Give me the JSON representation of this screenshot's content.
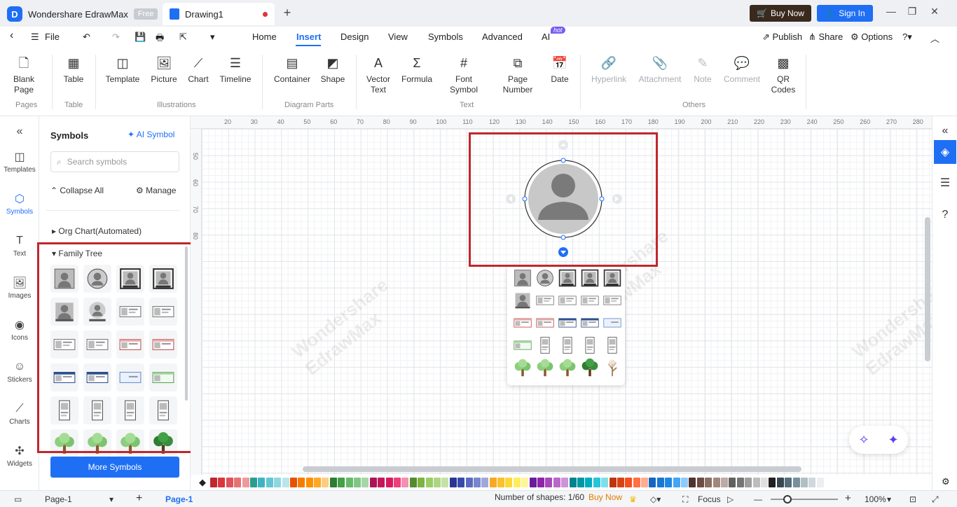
{
  "titlebar": {
    "app_name": "Wondershare EdrawMax",
    "free_badge": "Free",
    "doc_tab": "Drawing1",
    "buy_now": "Buy Now",
    "sign_in": "Sign In"
  },
  "menu": {
    "file": "File",
    "tabs": [
      "Home",
      "Insert",
      "Design",
      "View",
      "Symbols",
      "Advanced",
      "AI"
    ],
    "active_tab": "Insert",
    "hot_badge": "hot",
    "publish": "Publish",
    "share": "Share",
    "options": "Options"
  },
  "ribbon": {
    "buttons": [
      {
        "label": "Blank Page",
        "icon": "blank-page-icon"
      },
      {
        "label": "Table",
        "icon": "table-icon"
      },
      {
        "label": "Template",
        "icon": "template-icon"
      },
      {
        "label": "Picture",
        "icon": "picture-icon"
      },
      {
        "label": "Chart",
        "icon": "chart-icon"
      },
      {
        "label": "Timeline",
        "icon": "timeline-icon"
      },
      {
        "label": "Container",
        "icon": "container-icon"
      },
      {
        "label": "Shape",
        "icon": "shape-icon"
      },
      {
        "label": "Vector Text",
        "icon": "vector-text-icon"
      },
      {
        "label": "Formula",
        "icon": "formula-icon"
      },
      {
        "label": "Font Symbol",
        "icon": "font-symbol-icon"
      },
      {
        "label": "Page Number",
        "icon": "page-number-icon"
      },
      {
        "label": "Date",
        "icon": "date-icon"
      },
      {
        "label": "Hyperlink",
        "icon": "hyperlink-icon"
      },
      {
        "label": "Attachment",
        "icon": "attachment-icon"
      },
      {
        "label": "Note",
        "icon": "note-icon"
      },
      {
        "label": "Comment",
        "icon": "comment-icon"
      },
      {
        "label": "QR Codes",
        "icon": "qr-code-icon"
      }
    ],
    "groups": [
      "Pages",
      "Table",
      "Illustrations",
      "Diagram Parts",
      "Text",
      "Others"
    ]
  },
  "rail": {
    "items": [
      "Templates",
      "Symbols",
      "Text",
      "Images",
      "Icons",
      "Stickers",
      "Charts",
      "Widgets"
    ],
    "active": "Symbols"
  },
  "symbols_panel": {
    "title": "Symbols",
    "ai_symbol": "AI Symbol",
    "search_placeholder": "Search symbols",
    "collapse_all": "Collapse All",
    "manage": "Manage",
    "categories": [
      "Org Chart(Automated)",
      "Family Tree"
    ],
    "more_symbols": "More Symbols"
  },
  "ruler": {
    "top_ticks": [
      "20",
      "30",
      "40",
      "50",
      "60",
      "70",
      "80",
      "90",
      "100",
      "110",
      "120",
      "130",
      "140",
      "150",
      "160",
      "170",
      "180",
      "190",
      "200",
      "210",
      "220",
      "230",
      "240",
      "250",
      "260",
      "270",
      "280"
    ],
    "left_ticks": [
      "50",
      "60",
      "70",
      "80"
    ]
  },
  "watermark": {
    "line1": "Wondershare",
    "line2": "EdrawMax"
  },
  "status": {
    "page_select": "Page-1",
    "page_tab": "Page-1",
    "shapes_count": "Number of shapes: 1/60",
    "buy_now": "Buy Now",
    "focus": "Focus",
    "zoom": "100%"
  },
  "colors": {
    "accent": "#1f6ff5",
    "highlight_box": "#c0272d",
    "palette": [
      "#c0272d",
      "#d9363e",
      "#e0525a",
      "#e57373",
      "#ef9a9a",
      "#2a9d8f",
      "#3fb3c4",
      "#63c6d3",
      "#8fd6e0",
      "#b8e6ec",
      "#e65100",
      "#f57c00",
      "#ff8f00",
      "#ffa726",
      "#ffcc80",
      "#2e7d32",
      "#43a047",
      "#66bb6a",
      "#81c784",
      "#a5d6a7",
      "#ad1457",
      "#c2185b",
      "#d81b60",
      "#ec407a",
      "#f48fb1",
      "#558b2f",
      "#7cb342",
      "#9ccc65",
      "#aed581",
      "#c5e1a5",
      "#283593",
      "#3949ab",
      "#5c6bc0",
      "#7986cb",
      "#9fa8da",
      "#f9a825",
      "#fbc02d",
      "#fdd835",
      "#ffee58",
      "#fff59d",
      "#6a1b9a",
      "#8e24aa",
      "#ab47bc",
      "#ba68c8",
      "#ce93d8",
      "#00838f",
      "#0097a7",
      "#00acc1",
      "#26c6da",
      "#80deea",
      "#bf360c",
      "#d84315",
      "#f4511e",
      "#ff7043",
      "#ffab91",
      "#1565c0",
      "#1976d2",
      "#1e88e5",
      "#42a5f5",
      "#90caf9",
      "#4e342e",
      "#6d4c41",
      "#8d6e63",
      "#a1887f",
      "#bcaaa4",
      "#616161",
      "#757575",
      "#9e9e9e",
      "#bdbdbd",
      "#e0e0e0",
      "#212121",
      "#37474f",
      "#546e7a",
      "#78909c",
      "#b0bec5",
      "#cfd8dc",
      "#eceff1"
    ]
  }
}
